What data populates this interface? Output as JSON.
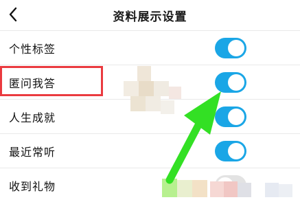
{
  "header": {
    "title": "资料展示设置",
    "back_icon": "chevron-left-icon"
  },
  "settings": [
    {
      "label": "个性标签",
      "enabled": true
    },
    {
      "label": "匿问我答",
      "enabled": true
    },
    {
      "label": "人生成就",
      "enabled": true
    },
    {
      "label": "最近常听",
      "enabled": true
    },
    {
      "label": "收到礼物",
      "enabled": false
    }
  ],
  "annotation": {
    "highlight_color": "#ea3a3f",
    "arrow_color": "#33e024",
    "toggle_on_color": "#1aa6e6"
  }
}
